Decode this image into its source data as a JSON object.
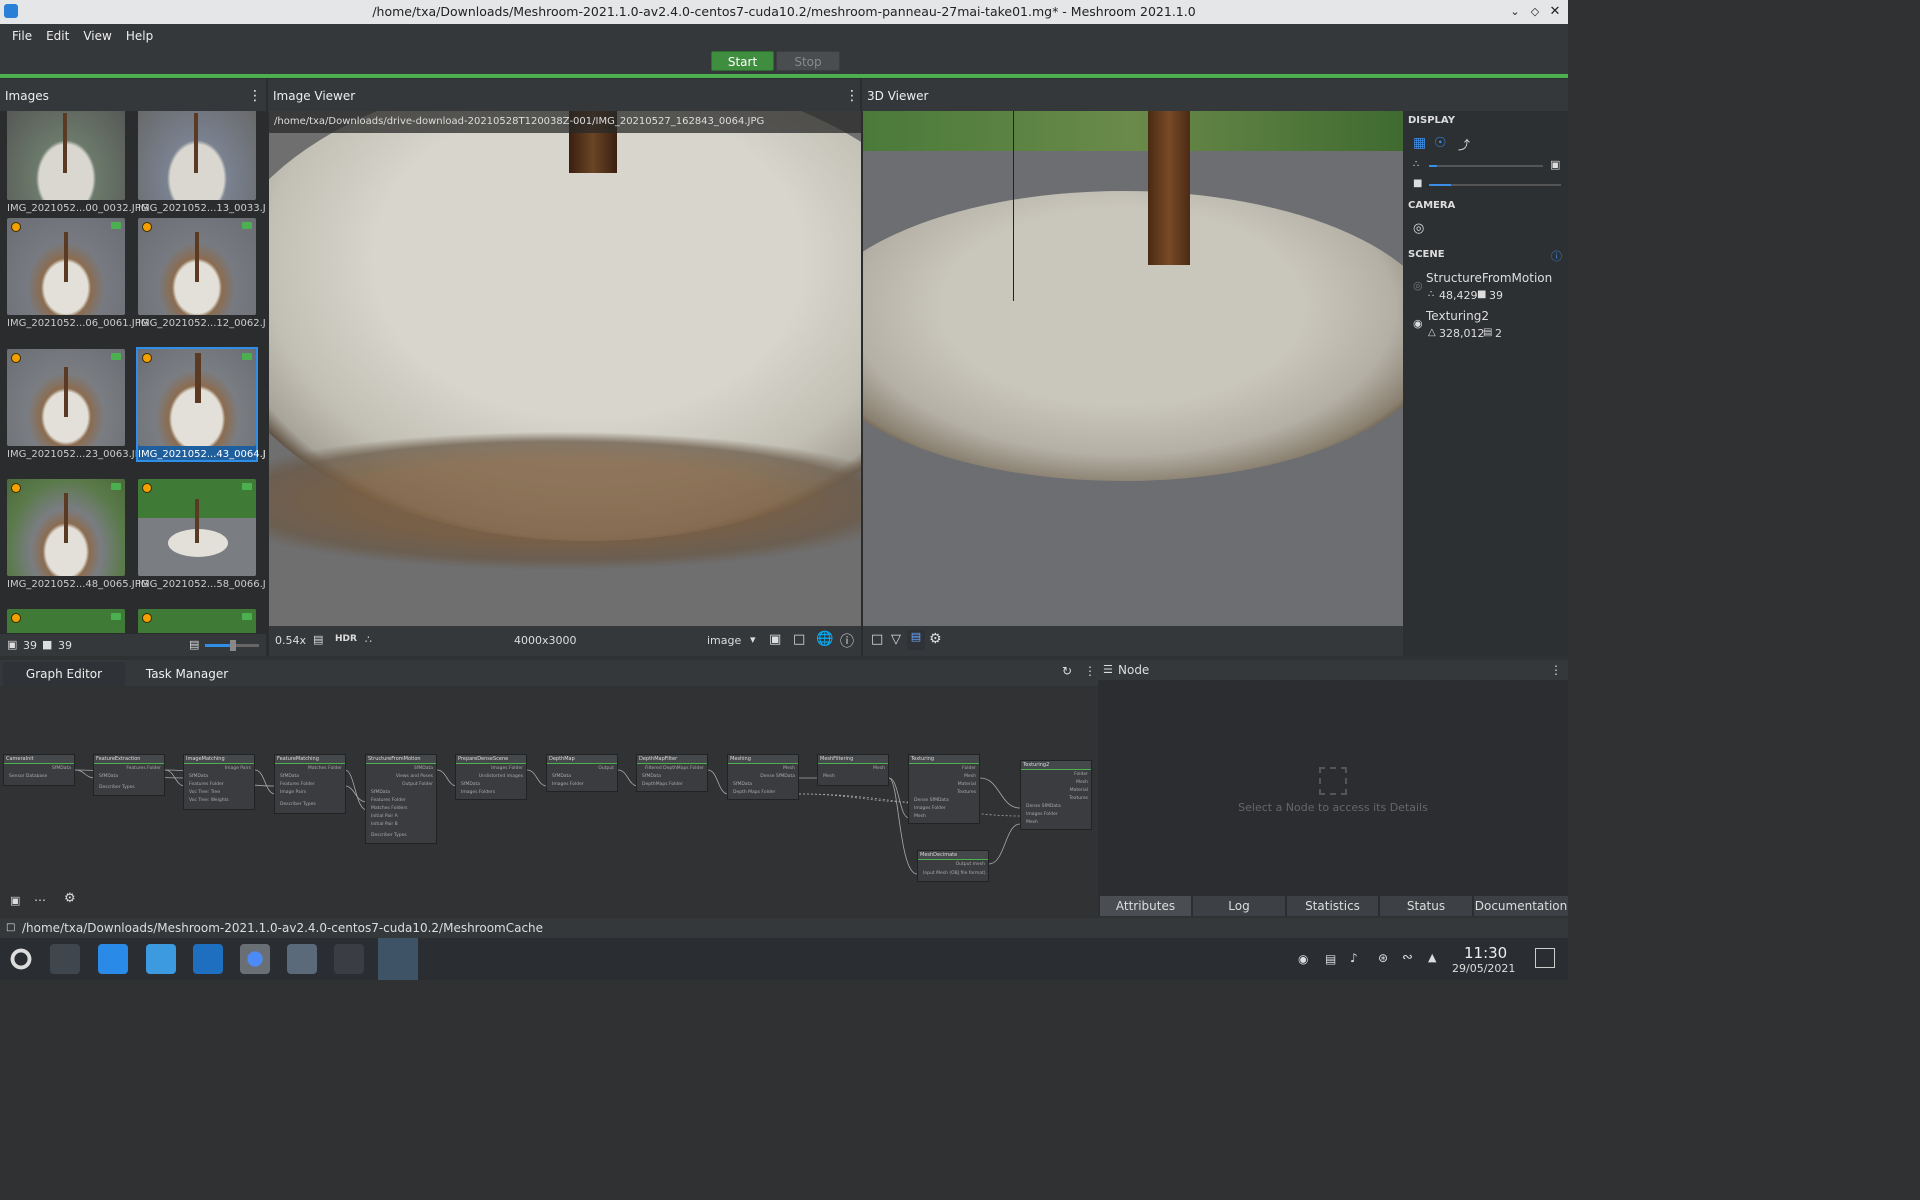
{
  "window": {
    "title": "/home/txa/Downloads/Meshroom-2021.1.0-av2.4.0-centos7-cuda10.2/meshroom-panneau-27mai-take01.mg* - Meshroom 2021.1.0"
  },
  "menu": [
    "File",
    "Edit",
    "View",
    "Help"
  ],
  "toolbar": {
    "start": "Start",
    "stop": "Stop"
  },
  "images_panel": {
    "title": "Images",
    "thumbs": [
      {
        "label": "IMG_2021052...00_0032.JPG"
      },
      {
        "label": "IMG_2021052...13_0033.JPG"
      },
      {
        "label": "IMG_2021052...06_0061.JPG"
      },
      {
        "label": "IMG_2021052...12_0062.JPG"
      },
      {
        "label": "IMG_2021052...23_0063.JPG"
      },
      {
        "label": "IMG_2021052...43_0064.JPG"
      },
      {
        "label": "IMG_2021052...48_0065.JPG"
      },
      {
        "label": "IMG_2021052...58_0066.JPG"
      }
    ],
    "image_count": "39",
    "camera_count": "39",
    "intrinsics_count": "39"
  },
  "image_viewer": {
    "title": "Image Viewer",
    "path": "/home/txa/Downloads/drive-download-20210528T120038Z-001/IMG_20210527_162843_0064.JPG",
    "zoom": "0.54x",
    "hdr": "HDR",
    "resolution": "4000x3000",
    "mode": "image"
  },
  "viewer3d": {
    "title": "3D Viewer",
    "display_label": "DISPLAY",
    "camera_label": "CAMERA",
    "scene_label": "SCENE",
    "scene_items": [
      {
        "name": "StructureFromMotion",
        "stat1": "48,429",
        "stat2": "39"
      },
      {
        "name": "Texturing2",
        "stat1": "328,012",
        "stat2": "2"
      }
    ]
  },
  "graph_editor": {
    "tabs": [
      "Graph Editor",
      "Task Manager"
    ],
    "nodes": [
      {
        "title": "CameraInit",
        "ports": [
          "SfMData",
          "Sensor Database"
        ]
      },
      {
        "title": "FeatureExtraction",
        "ports": [
          "Features Folder",
          "SfMData",
          "Describer Types"
        ]
      },
      {
        "title": "ImageMatching",
        "ports": [
          "Image Pairs",
          "SfMData",
          "Features Folder",
          "Voc Tree: Tree",
          "Voc Tree: Weights"
        ]
      },
      {
        "title": "FeatureMatching",
        "ports": [
          "Matches Folder",
          "SfMData",
          "Features Folder",
          "Image Pairs",
          "Describer Types"
        ]
      },
      {
        "title": "StructureFromMotion",
        "ports": [
          "SfMData",
          "Views and Poses",
          "Output Folder",
          "SfMData",
          "Features Folder",
          "Matches Folders",
          "Initial Pair A",
          "Initial Pair B",
          "Describer Types"
        ]
      },
      {
        "title": "PrepareDenseScene",
        "ports": [
          "Images Folder",
          "Undistorted images",
          "SfMData",
          "Images Folders"
        ]
      },
      {
        "title": "DepthMap",
        "ports": [
          "Output",
          "SfMData",
          "Images Folder"
        ]
      },
      {
        "title": "DepthMapFilter",
        "ports": [
          "Filtered DepthMaps Folder",
          "SfMData",
          "DepthMaps Folder"
        ]
      },
      {
        "title": "Meshing",
        "ports": [
          "Mesh",
          "Dense SfMData",
          "SfMData",
          "Depth Maps Folder"
        ]
      },
      {
        "title": "MeshFiltering",
        "ports": [
          "Mesh",
          "Mesh"
        ]
      },
      {
        "title": "Texturing",
        "ports": [
          "Folder",
          "Mesh",
          "Material",
          "Textures",
          "Dense SfMData",
          "Images Folder",
          "Mesh"
        ]
      },
      {
        "title": "Texturing2",
        "ports": [
          "Folder",
          "Mesh",
          "Material",
          "Textures",
          "Dense SfMData",
          "Images Folder",
          "Mesh"
        ]
      },
      {
        "title": "MeshDecimate",
        "ports": [
          "Output mesh",
          "Input Mesh (OBJ file format)."
        ]
      }
    ]
  },
  "node_panel": {
    "title": "Node",
    "empty_text": "Select a Node to access its Details",
    "tabs": [
      "Attributes",
      "Log",
      "Statistics",
      "Status",
      "Documentation"
    ]
  },
  "statusbar": {
    "path": "/home/txa/Downloads/Meshroom-2021.1.0-av2.4.0-centos7-cuda10.2/MeshroomCache"
  },
  "taskbar": {
    "time": "11:30",
    "date": "29/05/2021"
  }
}
